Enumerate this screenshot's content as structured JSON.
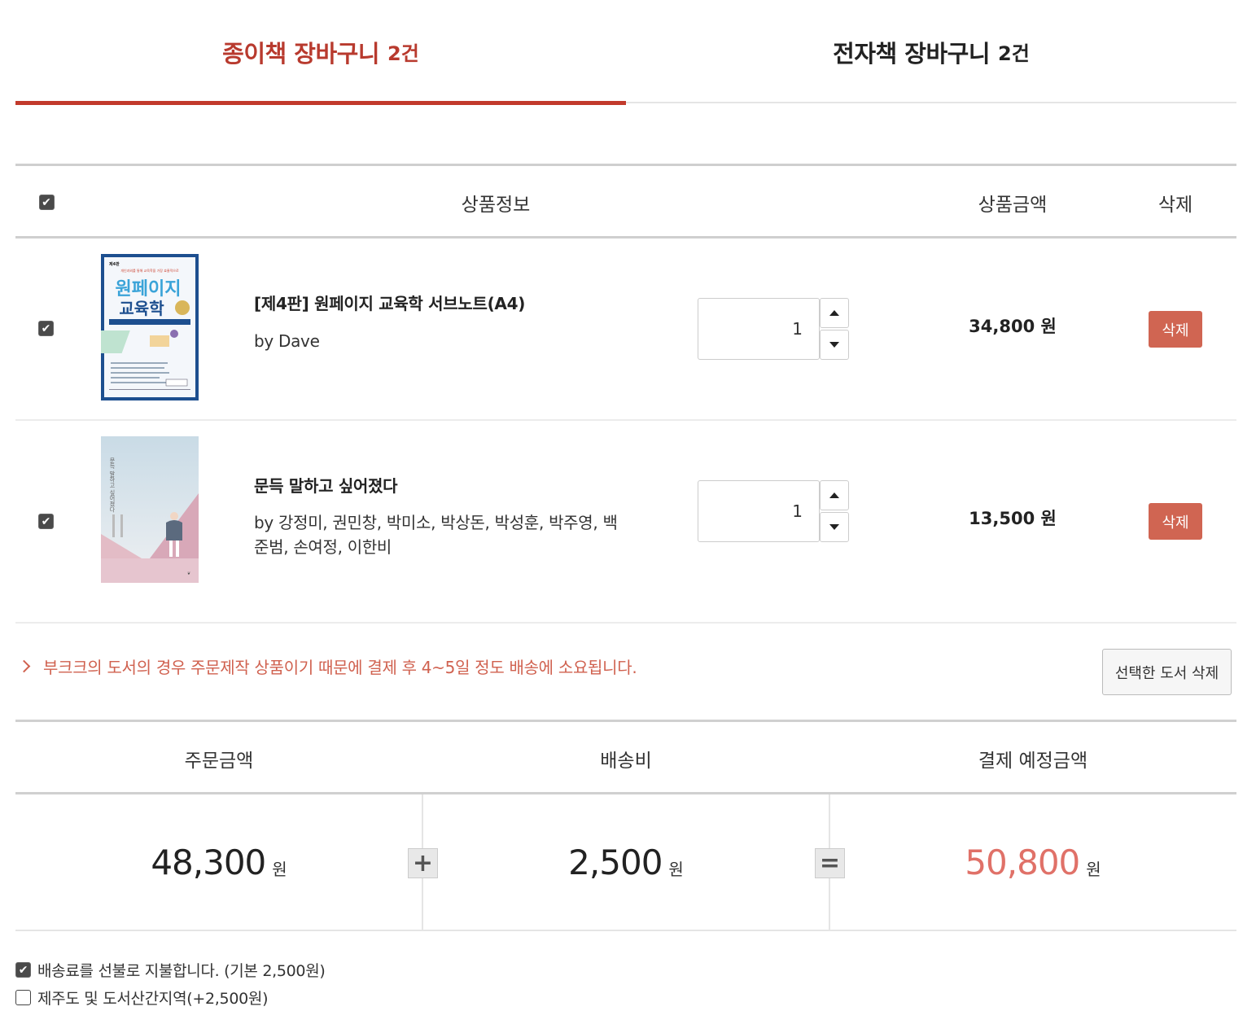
{
  "tabs": [
    {
      "label": "종이책 장바구니",
      "count": "2건",
      "active": true
    },
    {
      "label": "전자책 장바구니",
      "count": "2건",
      "active": false
    }
  ],
  "table_header": {
    "info": "상품정보",
    "price": "상품금액",
    "delete": "삭제"
  },
  "items": [
    {
      "title": "[제4판] 원페이지 교육학 서브노트(A4)",
      "author": "by Dave",
      "quantity": "1",
      "price": "34,800 원",
      "delete_label": "삭제",
      "cover": {
        "top_text": "제4판",
        "subtitle": "개인과외를 통해 교육학을 가장 효율적으로",
        "main_line1": "원페이지",
        "main_line2": "교육학",
        "author_text": "Dave 편저"
      }
    },
    {
      "title": "문득 말하고 싶어졌다",
      "author": "by 강정미, 권민창, 박미소, 박상돈, 박성훈, 박주영, 백준범, 손여정, 이한비",
      "quantity": "1",
      "price": "13,500 원",
      "delete_label": "삭제",
      "cover": {
        "vertical_text": "문득 말하고 싶어졌다"
      }
    }
  ],
  "notice": "부크크의 도서의 경우 주문제작 상품이기 때문에 결제 후 4~5일 정도 배송에 소요됩니다.",
  "selected_delete_label": "선택한 도서 삭제",
  "summary": {
    "headers": [
      "주문금액",
      "배송비",
      "결제 예정금액"
    ],
    "order_amount": "48,300",
    "shipping": "2,500",
    "total": "50,800",
    "unit": "원",
    "plus": "+",
    "equals": "="
  },
  "options": [
    {
      "label": "배송료를 선불로 지불합니다. (기본 2,500원)",
      "checked": true
    },
    {
      "label": "제주도 및 도서산간지역(+2,500원)",
      "checked": false
    }
  ],
  "colors": {
    "accent": "#c23a2c",
    "delete_button": "#d06552",
    "total": "#e07168",
    "notice": "#d0614f"
  }
}
